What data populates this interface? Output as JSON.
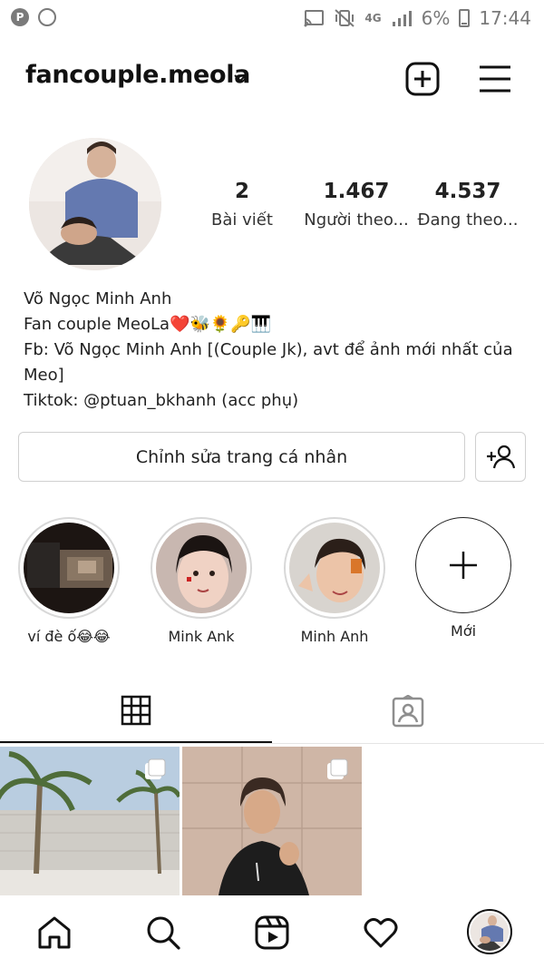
{
  "status_bar": {
    "network": "4G",
    "battery": "6%",
    "time": "17:44",
    "icons": [
      "pinterest-icon",
      "circle-icon",
      "cast-icon",
      "vibrate-icon",
      "signal-icon",
      "battery-icon"
    ]
  },
  "header": {
    "username": "fancouple.meola",
    "icons": [
      "chevron-down-icon",
      "new-post-icon",
      "menu-icon"
    ]
  },
  "profile": {
    "stats": [
      {
        "value": "2",
        "label": "Bài viết"
      },
      {
        "value": "1.467",
        "label": "Người theo..."
      },
      {
        "value": "4.537",
        "label": "Đang theo..."
      }
    ],
    "bio": {
      "name": "Võ Ngọc Minh Anh",
      "line1": "Fan couple MeoLa❤️🐝🌻🔑🎹",
      "line2": "Fb: Võ Ngọc Minh Anh [(Couple Jk), avt để ảnh mới nhất của Meo]",
      "line3": "Tiktok: @ptuan_bkhanh (acc phụ)"
    },
    "edit_button": "Chỉnh sửa trang cá nhân"
  },
  "highlights": [
    {
      "label": "ví đè ố😂😂"
    },
    {
      "label": "Mink Ank"
    },
    {
      "label": "Minh Anh"
    },
    {
      "label": "Mới"
    }
  ],
  "tabs": [
    "grid-icon",
    "tagged-icon"
  ],
  "bottom_nav": [
    "home-icon",
    "search-icon",
    "reels-icon",
    "heart-icon",
    "profile-avatar"
  ],
  "colors": {
    "text": "#262626",
    "border": "#d0d0d0",
    "icon": "#111111"
  }
}
